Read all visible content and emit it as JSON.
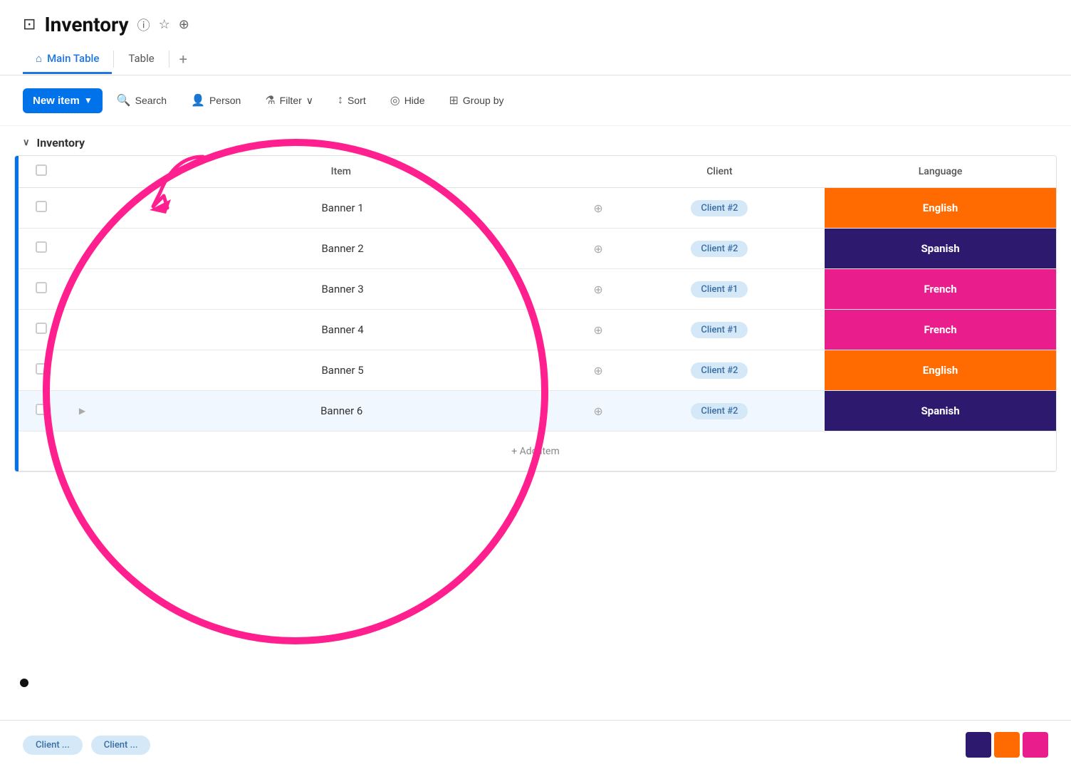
{
  "app": {
    "title": "Inventory",
    "icon": "📋"
  },
  "tabs": [
    {
      "id": "main-table",
      "label": "Main Table",
      "icon": "⌂",
      "active": true
    },
    {
      "id": "table",
      "label": "Table",
      "active": false
    }
  ],
  "toolbar": {
    "new_item_label": "New item",
    "search_label": "Search",
    "person_label": "Person",
    "filter_label": "Filter",
    "sort_label": "Sort",
    "hide_label": "Hide",
    "group_by_label": "Group by"
  },
  "group": {
    "name": "Inventory"
  },
  "table": {
    "columns": [
      {
        "id": "check",
        "label": ""
      },
      {
        "id": "item",
        "label": "Item"
      },
      {
        "id": "client",
        "label": "Client"
      },
      {
        "id": "language",
        "label": "Language"
      }
    ],
    "rows": [
      {
        "id": 1,
        "item": "Banner 1",
        "client": "Client #2",
        "language": "English",
        "lang_class": "lang-english"
      },
      {
        "id": 2,
        "item": "Banner 2",
        "client": "Client #2",
        "language": "Spanish",
        "lang_class": "lang-spanish"
      },
      {
        "id": 3,
        "item": "Banner 3",
        "client": "Client #1",
        "language": "French",
        "lang_class": "lang-french"
      },
      {
        "id": 4,
        "item": "Banner 4",
        "client": "Client #1",
        "language": "French",
        "lang_class": "lang-french"
      },
      {
        "id": 5,
        "item": "Banner 5",
        "client": "Client #2",
        "language": "English",
        "lang_class": "lang-english"
      },
      {
        "id": 6,
        "item": "Banner 6",
        "client": "Client #2",
        "language": "Spanish",
        "lang_class": "lang-spanish",
        "active": true
      }
    ],
    "add_item_label": "+ Add item"
  },
  "bottom": {
    "client1_label": "Client ...",
    "client2_label": "Client ..."
  }
}
